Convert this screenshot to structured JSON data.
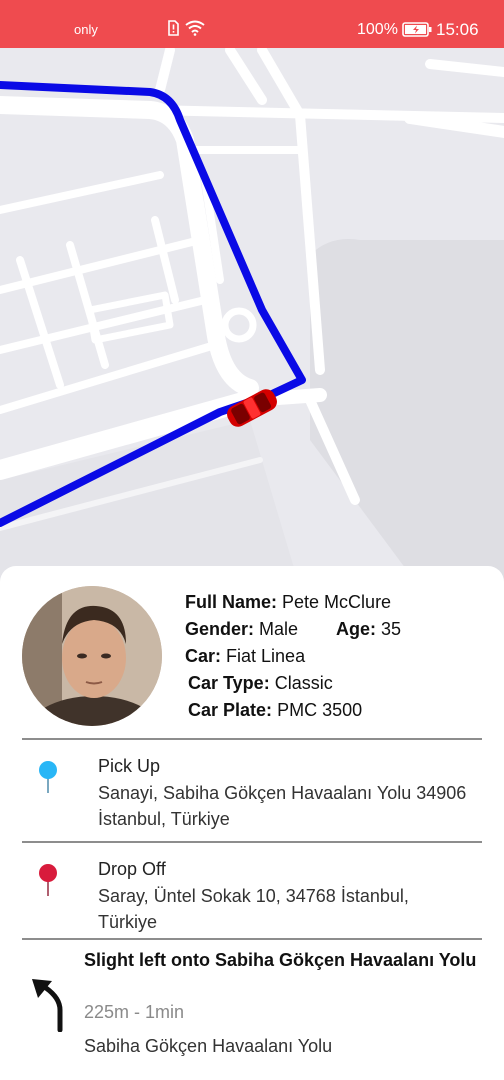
{
  "status_bar": {
    "carrier": "only",
    "battery": "100%",
    "time": "15:06"
  },
  "map": {
    "route_color": "#0000ee",
    "car_color": "#d90000"
  },
  "driver": {
    "full_name_label": "Full Name:",
    "full_name": "Pete McClure",
    "gender_label": "Gender:",
    "gender": "Male",
    "age_label": "Age:",
    "age": "35",
    "car_label": "Car:",
    "car": "Fiat Linea",
    "car_type_label": "Car Type:",
    "car_type": "Classic",
    "car_plate_label": "Car Plate:",
    "car_plate": "PMC 3500"
  },
  "pickup": {
    "title": "Pick Up",
    "address": "Sanayi, Sabiha Gökçen Havaalanı Yolu 34906 İstanbul, Türkiye",
    "pin_color": "#29b6f6"
  },
  "dropoff": {
    "title": "Drop Off",
    "address": "Saray, Üntel Sokak 10, 34768 İstanbul, Türkiye",
    "pin_color": "#d81b3c"
  },
  "navigation": {
    "instruction": "Slight left onto Sabiha Gökçen Havaalanı Yolu",
    "distance_time": "225m - 1min",
    "street": "Sabiha Gökçen Havaalanı Yolu",
    "icon": "turn-slight-left-icon"
  }
}
